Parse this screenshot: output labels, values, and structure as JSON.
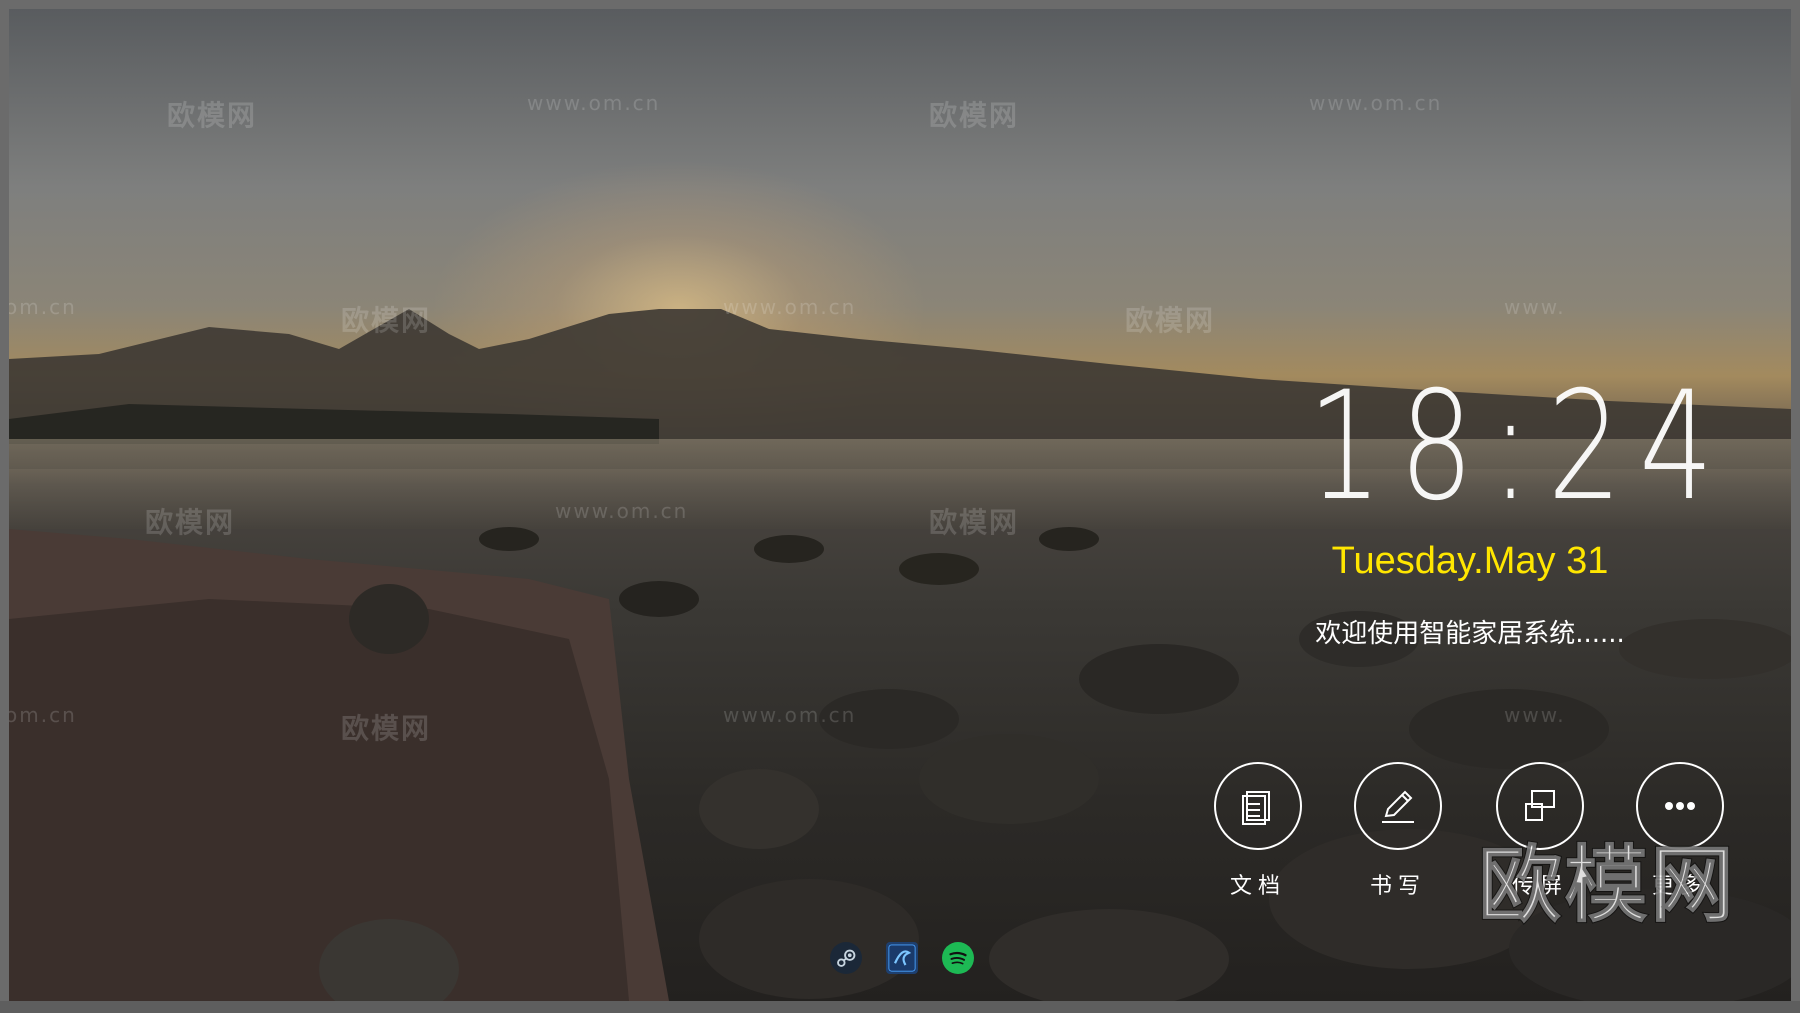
{
  "clock": {
    "time": "18:24"
  },
  "date": {
    "text": "Tuesday.May 31"
  },
  "welcome": {
    "text": "欢迎使用智能家居系统......"
  },
  "actions": [
    {
      "label": "文档",
      "icon": "document-icon"
    },
    {
      "label": "书写",
      "icon": "pen-icon"
    },
    {
      "label": "传屏",
      "icon": "screen-share-icon"
    },
    {
      "label": "更多",
      "icon": "more-icon"
    }
  ],
  "dock": [
    {
      "icon": "steam-icon"
    },
    {
      "icon": "app-icon"
    },
    {
      "icon": "spotify-icon"
    }
  ],
  "watermarks": {
    "cn": "欧模网",
    "url": "www.om.cn",
    "url_partial": "om.cn",
    "url_partial_2": "www.",
    "big": "欧模网"
  },
  "colors": {
    "date": "#ffe600",
    "text": "#ffffff",
    "spotify": "#1db954"
  }
}
